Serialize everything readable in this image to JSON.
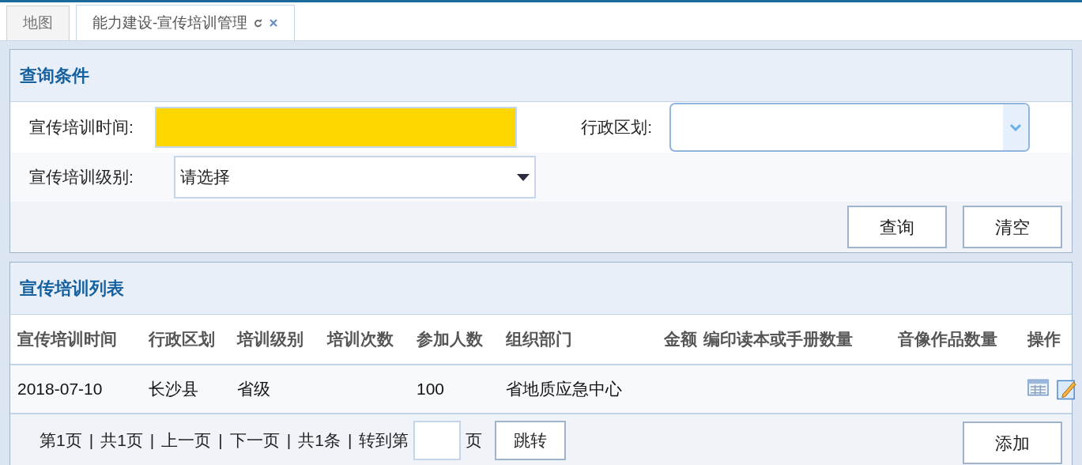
{
  "tabs": [
    {
      "label": "地图",
      "selected": false,
      "closable": false
    },
    {
      "label": "能力建设-宣传培训管理",
      "selected": true,
      "closable": true
    }
  ],
  "query_panel": {
    "title": "查询条件",
    "fields": [
      {
        "kind": "date",
        "label": "宣传培训时间:"
      },
      {
        "kind": "combo",
        "label": "行政区划:"
      },
      {
        "kind": "select",
        "label": "宣传培训级别:",
        "value": "请选择"
      }
    ],
    "buttons": [
      "查询",
      "清空"
    ]
  },
  "list_panel": {
    "title": "宣传培训列表",
    "table": {
      "columns": [
        "宣传培训时间",
        "行政区划",
        "培训级别",
        "培训次数",
        "参加人数",
        "组织部门",
        "金额",
        "编印读本或手册数量",
        "音像作品数量",
        "操作"
      ],
      "rows": [
        {
          "cells": [
            "2018-07-10",
            "长沙县",
            "省级",
            null,
            "100",
            "省地质应急中心",
            null,
            null,
            null,
            null
          ]
        }
      ]
    },
    "pagination": {
      "items": [
        "第1页",
        "共1页",
        "上一页",
        "下一页",
        "共1条",
        "转到第"
      ],
      "separator": "|",
      "suffix": "页",
      "jump_button": "跳转"
    },
    "add_button": "添加"
  }
}
